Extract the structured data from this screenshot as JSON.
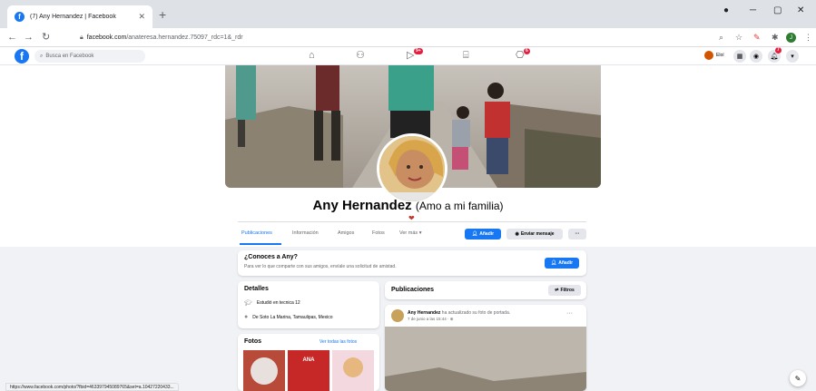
{
  "browser": {
    "tab_title": "(7) Any Hernandez | Facebook",
    "tab_close": "✕",
    "new_tab": "+",
    "url_host": "facebook.com",
    "url_path": "/anateresa.hernandez.75097_rdc=1&_rdr",
    "status_url": "https://www.facebook.com/photo/?fbid=463397945089765&set=a.10427220433..."
  },
  "facebook": {
    "search_placeholder": "Busca en Facebook",
    "badges": {
      "watch": "9+",
      "gaming": "6",
      "notifications": "7"
    },
    "account_name": "Eloí"
  },
  "profile": {
    "name": "Any Hernandez",
    "nickname": "(Amo a mi familia)",
    "tabs": [
      "Publicaciones",
      "Información",
      "Amigos",
      "Fotos",
      "Ver más ▾"
    ],
    "add_friend_label": "Añadir",
    "message_label": "Enviar mensaje",
    "more_label": "···"
  },
  "know_card": {
    "title": "¿Conoces a Any?",
    "subtitle": "Para ver lo que comparte con sus amigos, envíale una solicitud de amistad.",
    "button": "Añadir"
  },
  "details": {
    "title": "Detalles",
    "items": [
      {
        "icon": "graduation-cap-icon",
        "text": "Estudió en tecnica 12"
      },
      {
        "icon": "location-pin-icon",
        "text": "De Soto La Marina, Tamaulipas, Mexico"
      }
    ]
  },
  "photos": {
    "title": "Fotos",
    "see_all": "Ver todas las fotos",
    "poster_text": "ANA"
  },
  "posts": {
    "title": "Publicaciones",
    "filters_label": "Filtros",
    "post_author": "Any Hernandez",
    "post_action": "ha actualizado su foto de portada.",
    "post_time": "7 de junio a las 15:44 · ⊕",
    "post_menu": "···"
  },
  "colors": {
    "fb_blue": "#1877f2",
    "page_bg": "#f0f2f5"
  }
}
